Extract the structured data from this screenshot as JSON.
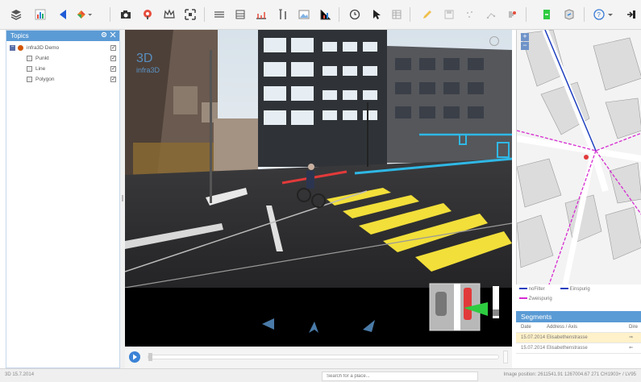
{
  "toolbar": {
    "buttons": [
      "layers-icon",
      "chart-icon",
      "back-icon",
      "diamond-menu-icon",
      "camera-icon",
      "target-icon",
      "crown-icon",
      "expand-icon",
      "lines-icon",
      "grid-icon",
      "ruler-icon",
      "height-icon",
      "image-icon",
      "graph-icon",
      "clock-icon",
      "cursor-icon",
      "table-icon",
      "pencil-icon",
      "save-icon",
      "points-icon",
      "connect-icon",
      "puzzle-icon",
      "export-icon",
      "share-icon",
      "help-icon",
      "logout-icon"
    ]
  },
  "topics": {
    "title": "Topics",
    "root_label": "infra3D Demo",
    "items": [
      {
        "label": "Punkt"
      },
      {
        "label": "Line"
      },
      {
        "label": "Polygon"
      }
    ]
  },
  "viewer": {
    "logo_text": "infra3D",
    "colors": {
      "accent": "#5b9bd5",
      "crosswalk": "#f2df3a",
      "overlay_cyan": "#2fb8e6",
      "overlay_red": "#e23a3a"
    }
  },
  "legend": {
    "items": [
      {
        "label": "noFilter",
        "color": "#1f3fbf"
      },
      {
        "label": "Einspurig",
        "color": "#1f3fbf"
      },
      {
        "label": "Zweispurig",
        "color": "#d62ad1"
      }
    ]
  },
  "segments": {
    "title": "Segments",
    "columns": [
      "Date",
      "Address / Axis",
      "Dire"
    ],
    "rows": [
      {
        "date": "15.07.2014",
        "address": "Elisabethenstrasse",
        "dir": "⇒"
      },
      {
        "date": "15.07.2014",
        "address": "Elisabethenstrasse",
        "dir": "⇐"
      }
    ]
  },
  "status": {
    "left": "3D  15.7.2014",
    "search_placeholder": "Search for a place...",
    "right": "Image position: 2611541.91 1267004.67 271  CH1903+ / LV95"
  }
}
